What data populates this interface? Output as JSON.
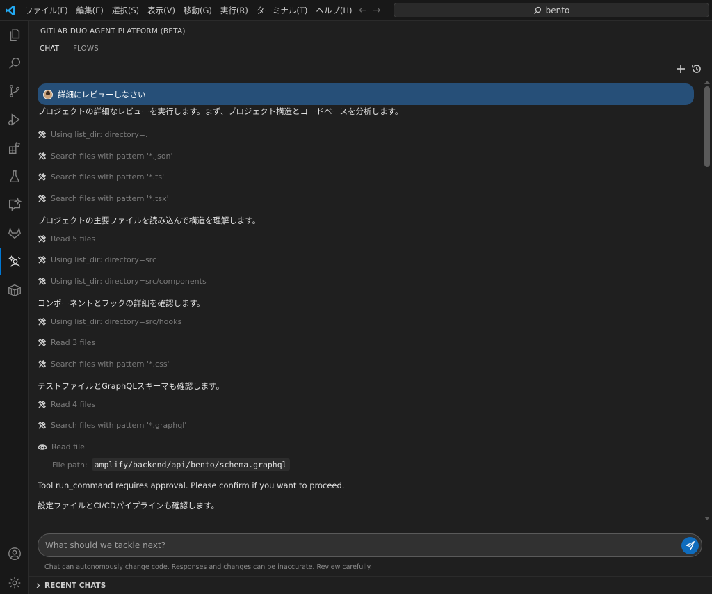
{
  "menu": [
    "ファイル(F)",
    "編集(E)",
    "選択(S)",
    "表示(V)",
    "移動(G)",
    "実行(R)",
    "ターミナル(T)",
    "ヘルプ(H)"
  ],
  "search": {
    "text": "bento"
  },
  "activity": [
    "explorer-icon",
    "search-icon",
    "source-control-icon",
    "run-debug-icon",
    "extensions-icon",
    "testing-icon",
    "chat-icon",
    "gitlab-icon",
    "duo-icon",
    "package-icon",
    "account-icon",
    "settings-icon"
  ],
  "panel": {
    "title": "GITLAB DUO AGENT PLATFORM (BETA)",
    "tabs": [
      "CHAT",
      "FLOWS"
    ]
  },
  "chat": {
    "user_message": "詳細にレビューしなさい",
    "lines": [
      {
        "kind": "text",
        "text": "プロジェクトの詳細なレビューを実行します。まず、プロジェクト構造とコードベースを分析します。"
      },
      {
        "kind": "tool",
        "text": "Using list_dir: directory=."
      },
      {
        "kind": "tool",
        "text": "Search files with pattern '*.json'"
      },
      {
        "kind": "tool",
        "text": "Search files with pattern '*.ts'"
      },
      {
        "kind": "tool",
        "text": "Search files with pattern '*.tsx'"
      },
      {
        "kind": "text",
        "text": "プロジェクトの主要ファイルを読み込んで構造を理解します。"
      },
      {
        "kind": "tool",
        "text": "Read 5 files"
      },
      {
        "kind": "tool",
        "text": "Using list_dir: directory=src"
      },
      {
        "kind": "tool",
        "text": "Using list_dir: directory=src/components"
      },
      {
        "kind": "text",
        "text": "コンポーネントとフックの詳細を確認します。"
      },
      {
        "kind": "tool",
        "text": "Using list_dir: directory=src/hooks"
      },
      {
        "kind": "tool",
        "text": "Read 3 files"
      },
      {
        "kind": "tool",
        "text": "Search files with pattern '*.css'"
      },
      {
        "kind": "text",
        "text": "テストファイルとGraphQLスキーマも確認します。"
      },
      {
        "kind": "tool",
        "text": "Read 4 files"
      },
      {
        "kind": "tool",
        "text": "Search files with pattern '*.graphql'"
      },
      {
        "kind": "view",
        "text": "Read file"
      },
      {
        "kind": "text",
        "text": "Tool run_command requires approval. Please confirm if you want to proceed."
      },
      {
        "kind": "text",
        "text": "設定ファイルとCI/CDパイプラインも確認します。"
      }
    ],
    "file_path_label": "File path:",
    "file_path_value": "amplify/backend/api/bento/schema.graphql"
  },
  "input": {
    "placeholder": "What should we tackle next?"
  },
  "disclaimer": "Chat can autonomously change code. Responses and changes can be inaccurate. Review carefully.",
  "recent_chats": "RECENT CHATS",
  "colors": {
    "accent": "#0078d4",
    "user_bubble": "#264f78",
    "send_button": "#0f6cbd"
  }
}
